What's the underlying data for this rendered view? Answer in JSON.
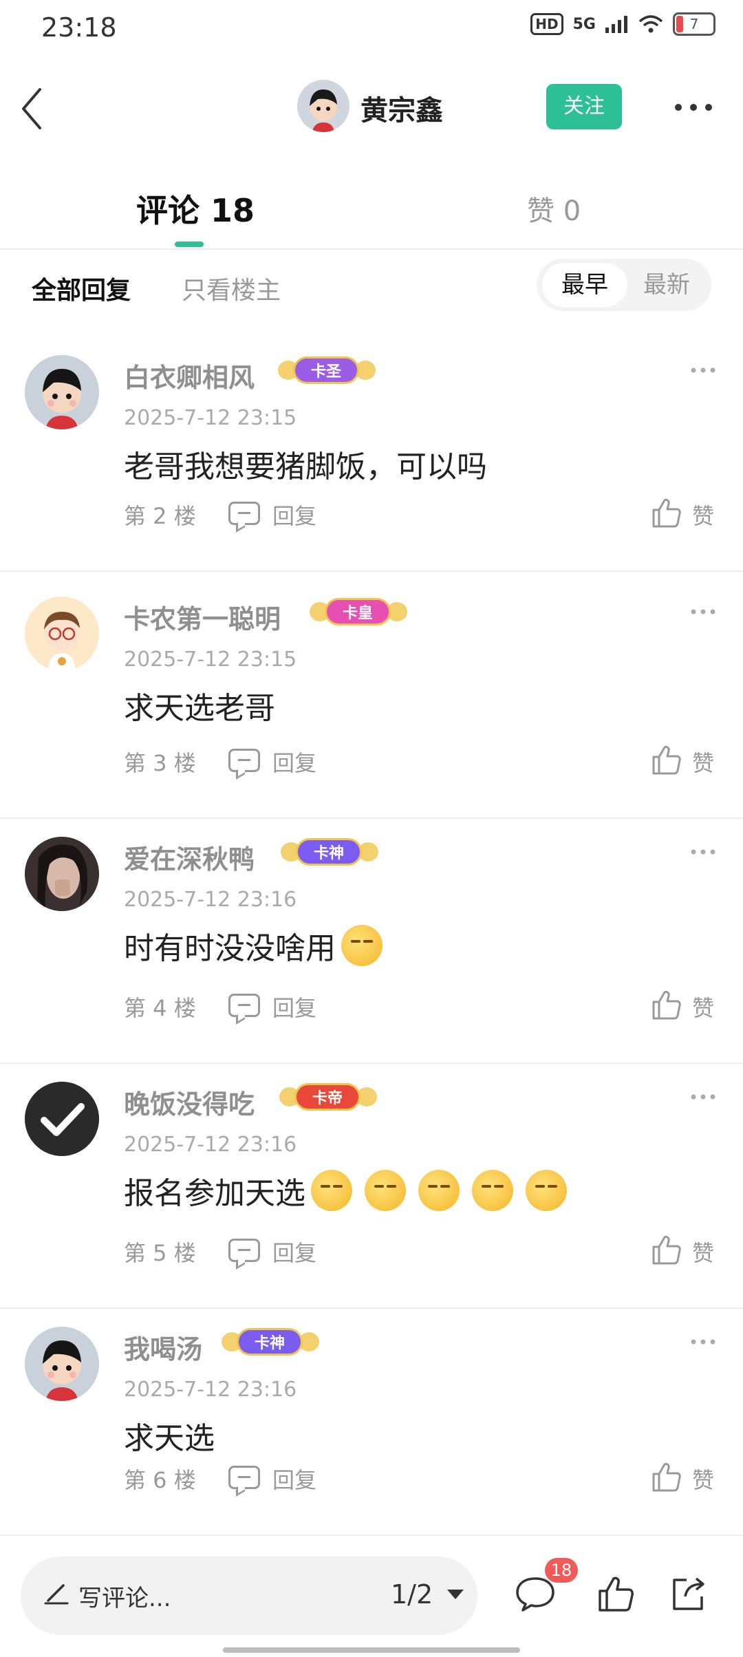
{
  "status_bar": {
    "time": "23:18",
    "network": "5G",
    "hd": "HD",
    "battery": "7",
    "battery_color": "#e94b4b"
  },
  "header": {
    "back_icon": "chevron-left-icon",
    "user_name": "黄宗鑫",
    "follow_label": "关注",
    "more_icon": "more-horizontal-icon",
    "accent_color": "#2dbf96"
  },
  "tabs": {
    "comments_label": "评论 18",
    "likes_label": "赞 0"
  },
  "filters": {
    "all_replies": "全部回复",
    "op_only": "只看楼主",
    "sort_earliest": "最早",
    "sort_latest": "最新"
  },
  "comments": [
    {
      "username": "白衣卿相风",
      "badge": "卡圣",
      "badge_color": "#9b5de5",
      "timestamp": "2025-7-12 23:15",
      "text": "老哥我想要猪脚饭，可以吗",
      "emoji_count": 0,
      "floor": "第 2 楼",
      "reply_label": "回复",
      "like_label": "赞"
    },
    {
      "username": "卡农第一聪明",
      "badge": "卡皇",
      "badge_color": "#e84fb3",
      "timestamp": "2025-7-12 23:15",
      "text": "求天选老哥",
      "emoji_count": 0,
      "floor": "第 3 楼",
      "reply_label": "回复",
      "like_label": "赞"
    },
    {
      "username": "爱在深秋鸭",
      "badge": "卡神",
      "badge_color": "#7a5cf0",
      "timestamp": "2025-7-12 23:16",
      "text": "时有时没没啥用",
      "emoji_count": 1,
      "floor": "第 4 楼",
      "reply_label": "回复",
      "like_label": "赞"
    },
    {
      "username": "晚饭没得吃",
      "badge": "卡帝",
      "badge_color": "#e8483a",
      "timestamp": "2025-7-12 23:16",
      "text": "报名参加天选",
      "emoji_count": 5,
      "floor": "第 5 楼",
      "reply_label": "回复",
      "like_label": "赞"
    },
    {
      "username": "我喝汤",
      "badge": "卡神",
      "badge_color": "#7a5cf0",
      "timestamp": "2025-7-12 23:16",
      "text": "求天选",
      "emoji_count": 0,
      "floor": "第 6 楼",
      "reply_label": "回复",
      "like_label": "赞"
    }
  ],
  "bottom_bar": {
    "placeholder": "写评论...",
    "page_indicator": "1/2",
    "comment_count": "18",
    "icons": [
      "pen-icon",
      "chat-bubble-icon",
      "thumbs-up-icon",
      "share-icon"
    ]
  }
}
